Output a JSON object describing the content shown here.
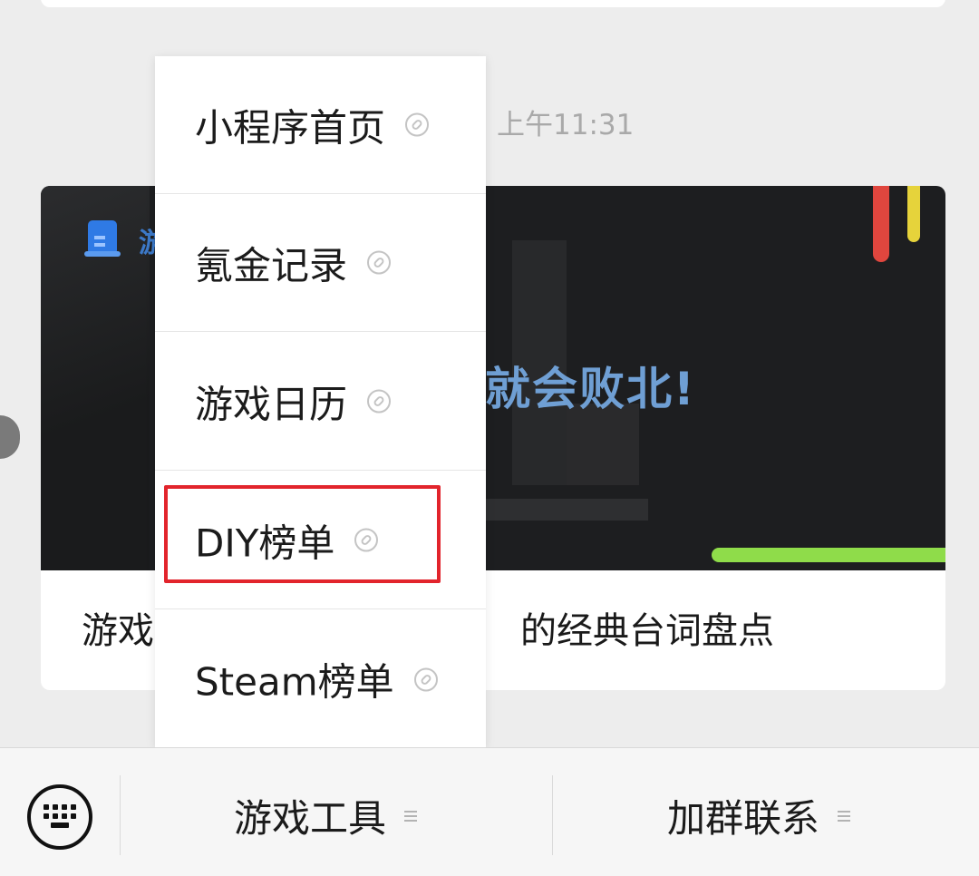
{
  "chat": {
    "timestamp": "上午11:31"
  },
  "article": {
    "cover_brand_char": "游",
    "cover_headline": "就会败北!",
    "title_left": "游戏",
    "title_right": "的经典台词盘点"
  },
  "popup_menu": {
    "items": [
      {
        "label": "小程序首页",
        "icon": "mini-program-link-icon"
      },
      {
        "label": "氪金记录",
        "icon": "mini-program-link-icon"
      },
      {
        "label": "游戏日历",
        "icon": "mini-program-link-icon"
      },
      {
        "label": "DIY榜单",
        "icon": "mini-program-link-icon"
      },
      {
        "label": "Steam榜单",
        "icon": "mini-program-link-icon"
      }
    ],
    "highlighted_item": "DIY榜单",
    "highlight_color": "#e2242c"
  },
  "bottom_bar": {
    "keyboard_icon": "keyboard-icon",
    "tabs": [
      {
        "label": "游戏工具",
        "icon": "menu-lines-icon"
      },
      {
        "label": "加群联系",
        "icon": "menu-lines-icon"
      }
    ]
  }
}
